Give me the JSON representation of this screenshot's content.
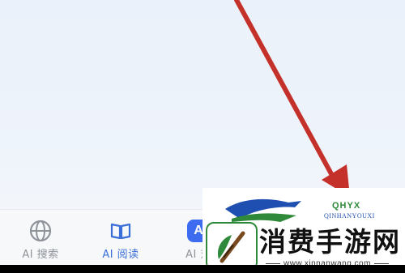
{
  "bottom_nav": {
    "items": [
      {
        "label": "AI 搜索",
        "icon": "globe-icon",
        "active": false
      },
      {
        "label": "AI 阅读",
        "icon": "book-icon",
        "active": true
      },
      {
        "label": "AI 对",
        "icon": "ai-badge-icon",
        "badge_text": "A",
        "active": false
      }
    ]
  },
  "watermark": {
    "title": "消费手游网",
    "url": "www.xinnanwang.com",
    "brand_code": "QHYX",
    "brand_sub": "QINHANYOUXI"
  },
  "colors": {
    "arrow": "#c4312a",
    "accent": "#3d6cf0",
    "watermark_green": "#2e8a3a"
  }
}
